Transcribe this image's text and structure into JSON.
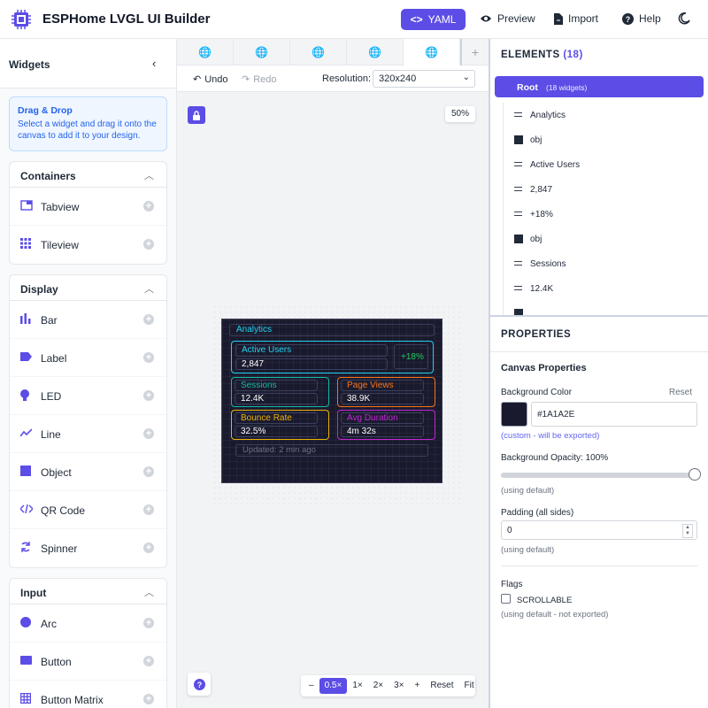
{
  "header": {
    "title": "ESPHome LVGL UI Builder",
    "yaml_label": "YAML",
    "preview_label": "Preview",
    "import_label": "Import",
    "help_label": "Help"
  },
  "widgets_panel": {
    "title": "Widgets",
    "dnd_title": "Drag & Drop",
    "dnd_text": "Select a widget and drag it onto the canvas to add it to your design.",
    "groups": [
      {
        "title": "Containers",
        "items": [
          "Tabview",
          "Tileview"
        ]
      },
      {
        "title": "Display",
        "items": [
          "Bar",
          "Label",
          "LED",
          "Line",
          "Object",
          "QR Code",
          "Spinner"
        ]
      },
      {
        "title": "Input",
        "items": [
          "Arc",
          "Button",
          "Button Matrix"
        ]
      }
    ]
  },
  "canvas": {
    "tabs": 5,
    "undo_label": "Undo",
    "redo_label": "Redo",
    "resolution_label": "Resolution:",
    "resolution_value": "320x240",
    "zoom_badge": "50%",
    "zoom_buttons": [
      "–",
      "0.5×",
      "1×",
      "2×",
      "3×",
      "+",
      "Reset",
      "Fit"
    ],
    "zoom_active": "0.5×"
  },
  "device": {
    "title": "Analytics",
    "hero": {
      "label": "Active Users",
      "value": "2,847",
      "delta": "+18%"
    },
    "cards": [
      {
        "label": "Sessions",
        "value": "12.4K",
        "color": "#14b8a6"
      },
      {
        "label": "Page Views",
        "value": "38.9K",
        "color": "#f97316"
      },
      {
        "label": "Bounce Rate",
        "value": "32.5%",
        "color": "#eab308"
      },
      {
        "label": "Avg Duration",
        "value": "4m 32s",
        "color": "#c026d3"
      }
    ],
    "updated": "Updated: 2 min ago",
    "colors": {
      "bg": "#1A1A2E",
      "accent": "#22d3ee",
      "delta": "#22c55e"
    }
  },
  "elements": {
    "title": "ELEMENTS",
    "count": "(18)",
    "root_label": "Root",
    "root_sub": "(18 widgets)",
    "items": [
      {
        "type": "label",
        "name": "Analytics"
      },
      {
        "type": "obj",
        "name": "obj"
      },
      {
        "type": "label",
        "name": "Active Users"
      },
      {
        "type": "label",
        "name": "2,847"
      },
      {
        "type": "label",
        "name": "+18%"
      },
      {
        "type": "obj",
        "name": "obj"
      },
      {
        "type": "label",
        "name": "Sessions"
      },
      {
        "type": "label",
        "name": "12.4K"
      },
      {
        "type": "obj",
        "name": ""
      }
    ]
  },
  "properties": {
    "title": "PROPERTIES",
    "section": "Canvas Properties",
    "bg_color_label": "Background Color",
    "reset_label": "Reset",
    "bg_color_value": "#1A1A2E",
    "bg_color_note": "(custom - will be exported)",
    "opacity_label": "Background Opacity: 100%",
    "opacity_value": 1.0,
    "opacity_note": "(using default)",
    "padding_label": "Padding (all sides)",
    "padding_value": "0",
    "padding_note": "(using default)",
    "flags_label": "Flags",
    "flag_scrollable": "SCROLLABLE",
    "flags_note": "(using default - not exported)"
  }
}
